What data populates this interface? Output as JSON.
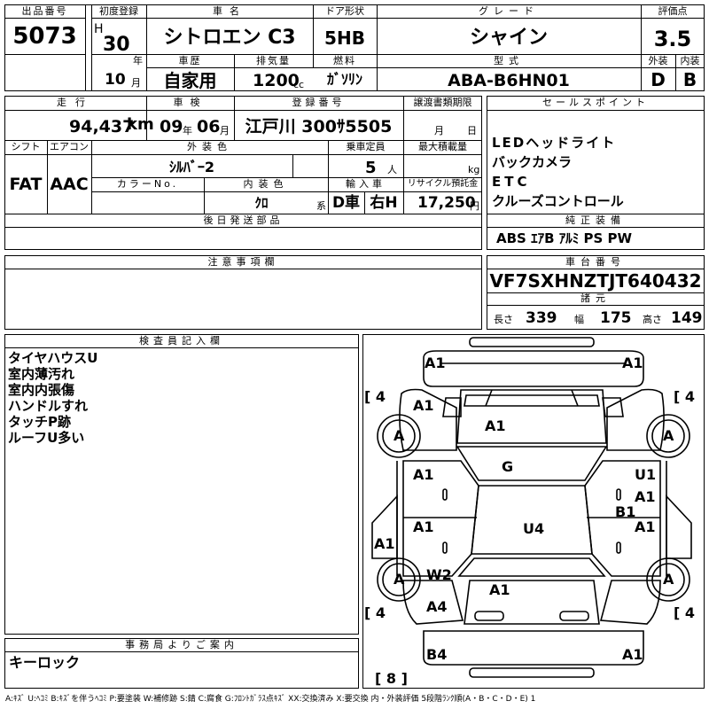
{
  "header": {
    "labels": {
      "lot_no": "出品番号",
      "first_reg": "初度登録",
      "car_name": "車名",
      "door": "ドア形状",
      "grade": "グレード",
      "score": "評価点",
      "history": "車歴",
      "displacement": "排気量",
      "fuel": "燃料",
      "model": "型式",
      "exterior": "外装",
      "interior": "内装"
    },
    "lot_no": "5073",
    "era": "H",
    "year": "30",
    "year_unit": "年",
    "month": "10",
    "month_unit": "月",
    "car_name": "シトロエン C3",
    "door": "5HB",
    "grade": "シャイン",
    "score": "3.5",
    "history": "自家用",
    "displacement": "1200",
    "displacement_unit": "cc",
    "fuel": "ｶﾞｿﾘﾝ",
    "model": "ABA-B6HN01",
    "exterior_grade": "D",
    "interior_grade": "B"
  },
  "row2": {
    "labels": {
      "mileage": "走行",
      "inspection": "車検",
      "reg_no": "登録番号",
      "transfer_doc": "譲渡書類期限"
    },
    "mileage": "94,437",
    "mileage_unit": "km",
    "insp_year": "09",
    "insp_year_unit": "年",
    "insp_month": "06",
    "insp_month_unit": "月",
    "reg_no": "江戸川 300ｻ5505",
    "transfer_month_unit": "月",
    "transfer_day_unit": "日"
  },
  "row3": {
    "labels": {
      "shift": "シフト",
      "ac": "エアコン",
      "ext_color": "外装色",
      "capacity": "乗車定員",
      "max_load": "最大積載量",
      "color_no": "カラーNo.",
      "int_color": "内装色",
      "import": "輸入車",
      "recycle": "リサイクル預託金"
    },
    "shift": "FAT",
    "ac": "AAC",
    "ext_color": "ｼﾙﾊﾞｰ2",
    "capacity": "5",
    "capacity_unit": "人",
    "max_load_unit": "kg",
    "int_color": "ｸﾛ",
    "int_color_unit": "系",
    "import_type": "D車",
    "handle": "右H",
    "recycle": "17,250",
    "recycle_unit": "円",
    "later_parts_label": "後日発送部品"
  },
  "sales_points": {
    "label": "セールスポイント",
    "items": [
      "LEDヘッドライト",
      "バックカメラ",
      "ETC",
      "クルーズコントロール"
    ]
  },
  "equipment": {
    "label": "純正装備",
    "value": "ABS ｴｱB ｱﾙﾐ PS PW"
  },
  "notes": {
    "label": "注意事項欄"
  },
  "chassis": {
    "label": "車台番号",
    "value": "VF7SXHNZTJT640432",
    "specs_label": "諸元",
    "length_label": "長さ",
    "length": "339",
    "width_label": "幅",
    "width": "175",
    "height_label": "高さ",
    "height": "149"
  },
  "inspector": {
    "label": "検査員記入欄",
    "items": [
      "タイヤハウスU",
      "室内薄汚れ",
      "室内内張傷",
      "ハンドルすれ",
      "タッチP跡",
      "ルーフU多い"
    ]
  },
  "office": {
    "label": "事務局よりご案内",
    "value": "キーロック"
  },
  "diagram": {
    "marks": {
      "front_bumper_left": "A1",
      "front_bumper_right": "A1",
      "fender_fl": "A1",
      "hood": "A1",
      "wheel_fl": "A",
      "wheel_fr": "A",
      "wheel_rl": "A",
      "wheel_rr": "A",
      "windshield": "G",
      "door_fl": "A1",
      "door_fr_a": "U1",
      "door_fr_b": "A1",
      "door_fr_c": "B1",
      "door_rl": "A1",
      "door_rr": "A1",
      "roof": "U4",
      "rocker_l": "A1",
      "quarter_l": "W2",
      "quarter_l2": "A4",
      "trunk": "A1",
      "rear_bumper_left": "B4",
      "rear_bumper_right": "A1"
    },
    "tire": {
      "fl": "4",
      "fr": "4",
      "rl": "4",
      "rr": "4",
      "spare": "8"
    },
    "tire_open": "[",
    "tire_close": "]"
  },
  "legend": "A:ｷｽﾞ U:ﾍｺﾐ B:ｷｽﾞを伴うﾍｺﾐ P:要塗装 W:補修跡 S:錆 C:腐食 G:ﾌﾛﾝﾄｶﾞﾗｽ点ｷｽﾞ XX:交換済み X:要交換  内・外装評価 5段階ﾗﾝｸ順(A・B・C・D・E) 1"
}
